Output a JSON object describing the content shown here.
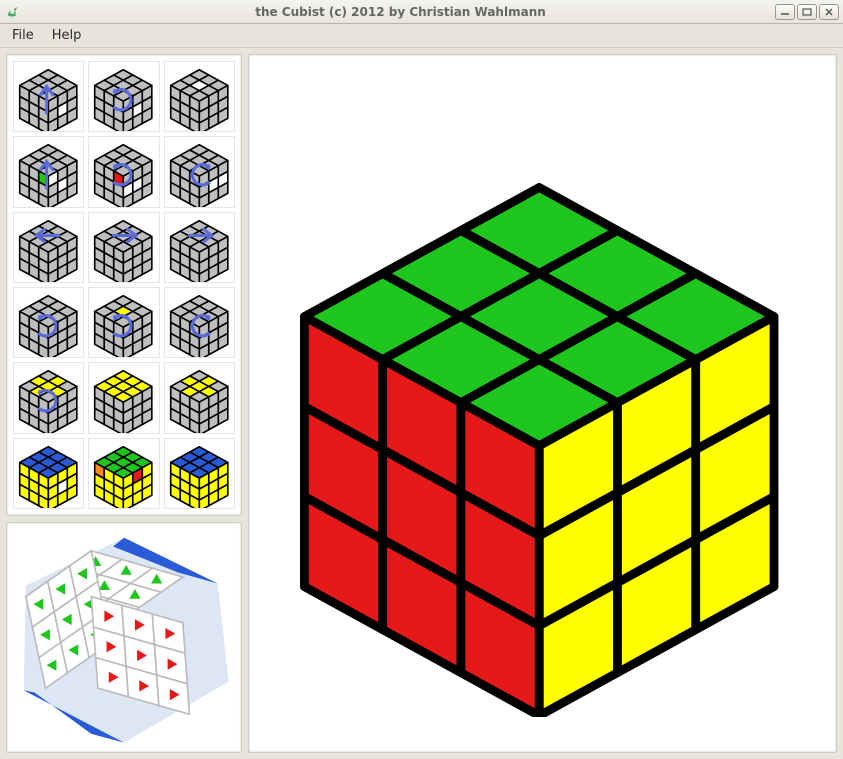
{
  "window": {
    "title": "the Cubist (c) 2012 by Christian Wahlmann"
  },
  "menu": {
    "file": "File",
    "help": "Help"
  },
  "cube": {
    "top_color": "#1EC61E",
    "front_color": "#FFFF00",
    "left_color": "#E61919",
    "edge_color": "#000000"
  },
  "palette": {
    "gray": "#BFBFBF",
    "white": "#FFFFFF",
    "yellow": "#FFFF00",
    "red": "#E61919",
    "green": "#1EC61E",
    "blue": "#2A5BD7",
    "orange": "#FF8C1A"
  },
  "thumbs": {
    "count": 18,
    "presets": [
      {
        "top": [
          "gray",
          "gray",
          "gray",
          "gray",
          "gray",
          "gray",
          "gray",
          "gray",
          "gray"
        ],
        "front": [
          "gray",
          "gray",
          "gray",
          "gray",
          "white",
          "gray",
          "gray",
          "gray",
          "gray"
        ],
        "left": [
          "gray",
          "gray",
          "gray",
          "gray",
          "gray",
          "gray",
          "gray",
          "gray",
          "gray"
        ],
        "arrow": "up-blue"
      },
      {
        "top": [
          "gray",
          "gray",
          "gray",
          "gray",
          "gray",
          "gray",
          "gray",
          "gray",
          "gray"
        ],
        "front": [
          "gray",
          "gray",
          "gray",
          "gray",
          "white",
          "gray",
          "gray",
          "gray",
          "gray"
        ],
        "left": [
          "gray",
          "gray",
          "gray",
          "gray",
          "gray",
          "gray",
          "gray",
          "gray",
          "gray"
        ],
        "arrow": "cw-blue"
      },
      {
        "top": [
          "gray",
          "gray",
          "gray",
          "gray",
          "white",
          "gray",
          "gray",
          "gray",
          "gray"
        ],
        "front": [
          "gray",
          "gray",
          "gray",
          "gray",
          "gray",
          "gray",
          "gray",
          "gray",
          "gray"
        ],
        "left": [
          "gray",
          "gray",
          "gray",
          "gray",
          "gray",
          "gray",
          "gray",
          "gray",
          "gray"
        ],
        "arrow": "none"
      },
      {
        "top": [
          "gray",
          "gray",
          "gray",
          "gray",
          "gray",
          "gray",
          "gray",
          "gray",
          "gray"
        ],
        "front": [
          "white",
          "gray",
          "gray",
          "gray",
          "white",
          "gray",
          "gray",
          "gray",
          "gray"
        ],
        "left": [
          "gray",
          "gray",
          "green",
          "gray",
          "gray",
          "gray",
          "gray",
          "gray",
          "gray"
        ],
        "arrow": "up-blue"
      },
      {
        "top": [
          "gray",
          "gray",
          "gray",
          "gray",
          "gray",
          "gray",
          "gray",
          "gray",
          "gray"
        ],
        "front": [
          "gray",
          "gray",
          "gray",
          "white",
          "white",
          "gray",
          "gray",
          "gray",
          "gray"
        ],
        "left": [
          "gray",
          "gray",
          "red",
          "gray",
          "gray",
          "gray",
          "gray",
          "gray",
          "gray"
        ],
        "arrow": "cw-blue"
      },
      {
        "top": [
          "gray",
          "gray",
          "gray",
          "gray",
          "gray",
          "gray",
          "gray",
          "gray",
          "gray"
        ],
        "front": [
          "gray",
          "gray",
          "gray",
          "gray",
          "white",
          "white",
          "gray",
          "gray",
          "gray"
        ],
        "left": [
          "gray",
          "gray",
          "gray",
          "gray",
          "gray",
          "gray",
          "gray",
          "gray",
          "gray"
        ],
        "arrow": "ccw-blue"
      },
      {
        "top": [
          "gray",
          "gray",
          "gray",
          "gray",
          "gray",
          "gray",
          "gray",
          "gray",
          "gray"
        ],
        "front": [
          "gray",
          "gray",
          "gray",
          "gray",
          "gray",
          "gray",
          "gray",
          "gray",
          "gray"
        ],
        "left": [
          "gray",
          "gray",
          "gray",
          "gray",
          "gray",
          "gray",
          "gray",
          "gray",
          "gray"
        ],
        "arrow": "left-blue"
      },
      {
        "top": [
          "gray",
          "gray",
          "gray",
          "gray",
          "gray",
          "gray",
          "gray",
          "gray",
          "gray"
        ],
        "front": [
          "gray",
          "gray",
          "gray",
          "gray",
          "gray",
          "gray",
          "gray",
          "gray",
          "gray"
        ],
        "left": [
          "gray",
          "gray",
          "gray",
          "gray",
          "gray",
          "gray",
          "gray",
          "gray",
          "gray"
        ],
        "arrow": "right-blue"
      },
      {
        "top": [
          "gray",
          "gray",
          "gray",
          "gray",
          "gray",
          "gray",
          "gray",
          "gray",
          "gray"
        ],
        "front": [
          "gray",
          "gray",
          "gray",
          "gray",
          "gray",
          "gray",
          "gray",
          "gray",
          "gray"
        ],
        "left": [
          "gray",
          "gray",
          "gray",
          "gray",
          "gray",
          "gray",
          "gray",
          "gray",
          "gray"
        ],
        "arrow": "right-blue"
      },
      {
        "top": [
          "gray",
          "gray",
          "gray",
          "gray",
          "gray",
          "gray",
          "gray",
          "gray",
          "gray"
        ],
        "front": [
          "gray",
          "gray",
          "gray",
          "gray",
          "gray",
          "gray",
          "gray",
          "gray",
          "gray"
        ],
        "left": [
          "gray",
          "gray",
          "gray",
          "gray",
          "gray",
          "gray",
          "gray",
          "gray",
          "gray"
        ],
        "arrow": "cw-blue"
      },
      {
        "top": [
          "gray",
          "gray",
          "gray",
          "gray",
          "yellow",
          "gray",
          "gray",
          "gray",
          "gray"
        ],
        "front": [
          "gray",
          "gray",
          "gray",
          "gray",
          "gray",
          "gray",
          "gray",
          "gray",
          "gray"
        ],
        "left": [
          "gray",
          "gray",
          "gray",
          "gray",
          "gray",
          "gray",
          "gray",
          "gray",
          "gray"
        ],
        "arrow": "cw-blue"
      },
      {
        "top": [
          "gray",
          "gray",
          "gray",
          "gray",
          "gray",
          "gray",
          "gray",
          "gray",
          "gray"
        ],
        "front": [
          "gray",
          "gray",
          "gray",
          "gray",
          "gray",
          "gray",
          "gray",
          "gray",
          "gray"
        ],
        "left": [
          "gray",
          "gray",
          "gray",
          "gray",
          "gray",
          "gray",
          "gray",
          "gray",
          "gray"
        ],
        "arrow": "ccw-blue"
      },
      {
        "top": [
          "gray",
          "yellow",
          "gray",
          "yellow",
          "yellow",
          "yellow",
          "gray",
          "yellow",
          "gray"
        ],
        "front": [
          "gray",
          "gray",
          "gray",
          "gray",
          "gray",
          "gray",
          "gray",
          "gray",
          "gray"
        ],
        "left": [
          "gray",
          "gray",
          "gray",
          "gray",
          "gray",
          "gray",
          "gray",
          "gray",
          "gray"
        ],
        "arrow": "cw-blue"
      },
      {
        "top": [
          "yellow",
          "yellow",
          "yellow",
          "yellow",
          "yellow",
          "yellow",
          "yellow",
          "yellow",
          "yellow"
        ],
        "front": [
          "gray",
          "gray",
          "gray",
          "gray",
          "gray",
          "gray",
          "gray",
          "gray",
          "gray"
        ],
        "left": [
          "gray",
          "gray",
          "gray",
          "gray",
          "gray",
          "gray",
          "gray",
          "gray",
          "gray"
        ],
        "arrow": "none"
      },
      {
        "top": [
          "gray",
          "yellow",
          "gray",
          "yellow",
          "yellow",
          "yellow",
          "gray",
          "yellow",
          "gray"
        ],
        "front": [
          "gray",
          "gray",
          "gray",
          "gray",
          "gray",
          "gray",
          "gray",
          "gray",
          "gray"
        ],
        "left": [
          "gray",
          "gray",
          "gray",
          "gray",
          "gray",
          "gray",
          "gray",
          "gray",
          "gray"
        ],
        "arrow": "none"
      },
      {
        "top": [
          "blue",
          "blue",
          "blue",
          "blue",
          "blue",
          "blue",
          "blue",
          "blue",
          "blue"
        ],
        "front": [
          "yellow",
          "yellow",
          "yellow",
          "yellow",
          "white",
          "yellow",
          "yellow",
          "yellow",
          "yellow"
        ],
        "left": [
          "yellow",
          "yellow",
          "yellow",
          "yellow",
          "yellow",
          "yellow",
          "yellow",
          "yellow",
          "yellow"
        ],
        "arrow": "none"
      },
      {
        "top": [
          "green",
          "green",
          "green",
          "green",
          "green",
          "green",
          "green",
          "green",
          "green"
        ],
        "front": [
          "yellow",
          "red",
          "yellow",
          "yellow",
          "yellow",
          "yellow",
          "yellow",
          "yellow",
          "yellow"
        ],
        "left": [
          "orange",
          "yellow",
          "yellow",
          "yellow",
          "yellow",
          "yellow",
          "yellow",
          "yellow",
          "yellow"
        ],
        "arrow": "none"
      },
      {
        "top": [
          "blue",
          "blue",
          "blue",
          "blue",
          "blue",
          "blue",
          "blue",
          "blue",
          "blue"
        ],
        "front": [
          "yellow",
          "yellow",
          "yellow",
          "yellow",
          "yellow",
          "yellow",
          "yellow",
          "yellow",
          "yellow"
        ],
        "left": [
          "yellow",
          "yellow",
          "yellow",
          "yellow",
          "yellow",
          "yellow",
          "yellow",
          "yellow",
          "yellow"
        ],
        "arrow": "none"
      }
    ]
  }
}
